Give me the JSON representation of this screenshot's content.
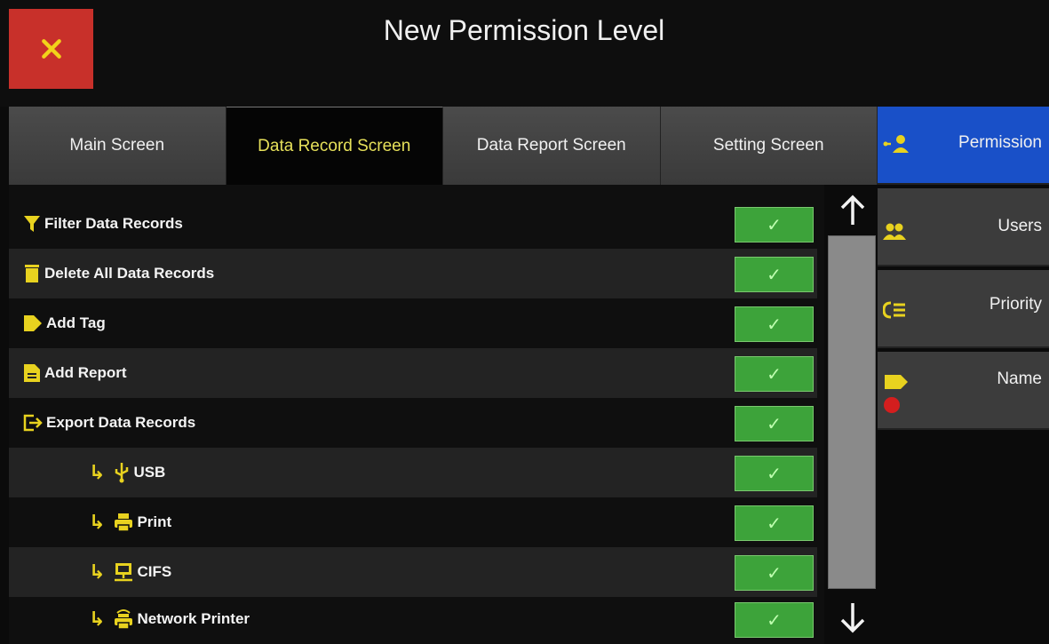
{
  "window": {
    "title": "New Permission Level"
  },
  "colors": {
    "accent": "#e8d21f",
    "close": "#c8302a",
    "active_side": "#1950c8",
    "check_green": "#3da33a"
  },
  "tabs": [
    {
      "label": "Main Screen",
      "active": false
    },
    {
      "label": "Data Record Screen",
      "active": true
    },
    {
      "label": "Data Report Screen",
      "active": false
    },
    {
      "label": "Setting Screen",
      "active": false
    }
  ],
  "sidebar": {
    "items": [
      {
        "label": "Permission",
        "icon": "permission-icon",
        "active": true
      },
      {
        "label": "Users",
        "icon": "users-icon",
        "active": false
      },
      {
        "label": "Priority",
        "icon": "priority-icon",
        "active": false
      },
      {
        "label": "Name",
        "icon": "name-tag-icon",
        "active": false
      }
    ]
  },
  "permissions": [
    {
      "label": "Filter Data Records",
      "icon": "filter-icon",
      "checked": true
    },
    {
      "label": "Delete All Data Records",
      "icon": "trash-icon",
      "checked": true
    },
    {
      "label": "Add Tag",
      "icon": "tag-icon",
      "checked": true
    },
    {
      "label": "Add Report",
      "icon": "report-icon",
      "checked": true
    },
    {
      "label": "Export Data Records",
      "icon": "export-icon",
      "checked": true
    },
    {
      "label": "USB",
      "icon": "usb-icon",
      "checked": true,
      "sub": true
    },
    {
      "label": "Print",
      "icon": "printer-icon",
      "checked": true,
      "sub": true
    },
    {
      "label": "CIFS",
      "icon": "network-share-icon",
      "checked": true,
      "sub": true
    },
    {
      "label": "Network Printer",
      "icon": "network-printer-icon",
      "checked": true,
      "sub": true
    }
  ],
  "check_glyph": "✓",
  "sub_arrow": "↳"
}
